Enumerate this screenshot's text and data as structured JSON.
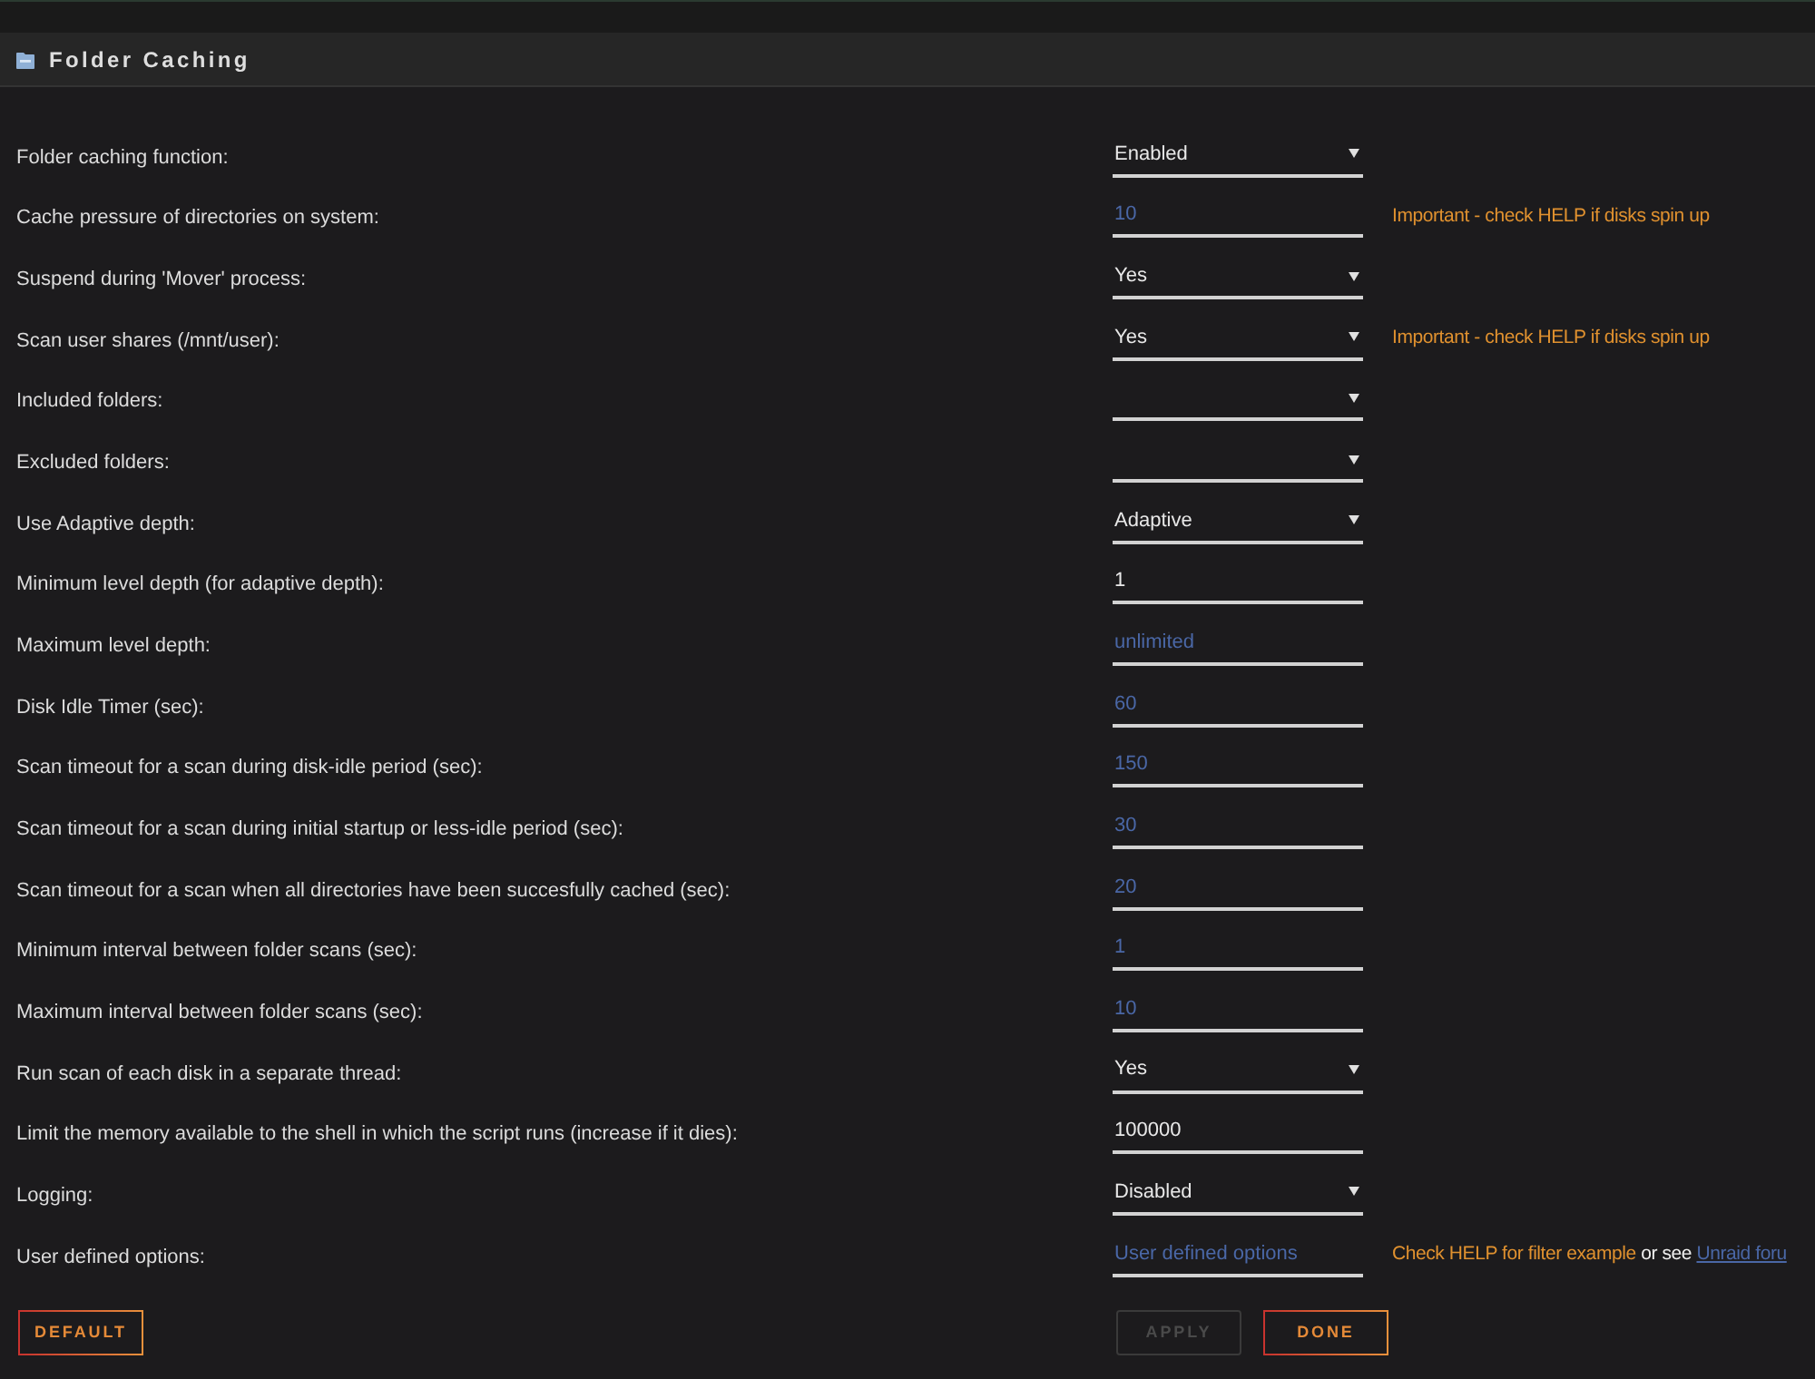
{
  "header": {
    "title": "Folder Caching"
  },
  "settings": [
    {
      "label": "Folder caching function:",
      "field": {
        "kind": "select",
        "value": "Enabled"
      }
    },
    {
      "label": "Cache pressure of directories on system:",
      "field": {
        "kind": "input",
        "placeholder": "10"
      },
      "note": [
        {
          "kind": "warning",
          "text": "Important - check HELP if disks spin up"
        }
      ]
    },
    {
      "label": "Suspend during 'Mover' process:",
      "field": {
        "kind": "select",
        "value": "Yes"
      }
    },
    {
      "label": "Scan user shares (/mnt/user):",
      "field": {
        "kind": "select",
        "value": "Yes"
      },
      "note": [
        {
          "kind": "warning",
          "text": "Important - check HELP if disks spin up"
        }
      ]
    },
    {
      "label": "Included folders:",
      "field": {
        "kind": "select"
      }
    },
    {
      "label": "Excluded folders:",
      "field": {
        "kind": "select"
      }
    },
    {
      "label": "Use Adaptive depth:",
      "field": {
        "kind": "select",
        "value": "Adaptive"
      }
    },
    {
      "label": "Minimum level depth (for adaptive depth):",
      "field": {
        "kind": "input",
        "value": "1"
      }
    },
    {
      "label": "Maximum level depth:",
      "field": {
        "kind": "input",
        "placeholder": "unlimited"
      }
    },
    {
      "label": "Disk Idle Timer (sec):",
      "field": {
        "kind": "input",
        "placeholder": "60"
      }
    },
    {
      "label": "Scan timeout for a scan during disk-idle period (sec):",
      "field": {
        "kind": "input",
        "placeholder": "150"
      }
    },
    {
      "label": "Scan timeout for a scan during initial startup or less-idle period (sec):",
      "field": {
        "kind": "input",
        "placeholder": "30"
      }
    },
    {
      "label": "Scan timeout for a scan when all directories have been succesfully cached (sec):",
      "field": {
        "kind": "input",
        "placeholder": "20"
      }
    },
    {
      "label": "Minimum interval between folder scans (sec):",
      "field": {
        "kind": "input",
        "placeholder": "1"
      }
    },
    {
      "label": "Maximum interval between folder scans (sec):",
      "field": {
        "kind": "input",
        "placeholder": "10"
      }
    },
    {
      "label": "Run scan of each disk in a separate thread:",
      "field": {
        "kind": "select",
        "value": "Yes"
      }
    },
    {
      "label": "Limit the memory available to the shell in which the script runs (increase if it dies):",
      "field": {
        "kind": "input",
        "value": "100000"
      }
    },
    {
      "label": "Logging:",
      "field": {
        "kind": "select",
        "value": "Disabled"
      }
    },
    {
      "label": "User defined options:",
      "field": {
        "kind": "input",
        "placeholder": "User defined options"
      },
      "note": [
        {
          "kind": "warning",
          "text": "Check HELP for filter example"
        },
        {
          "kind": "plain",
          "text": "or see"
        },
        {
          "kind": "link",
          "text": "Unraid foru"
        }
      ]
    }
  ],
  "buttons": [
    {
      "label": "DEFAULT",
      "disabled": false
    },
    {
      "label": "APPLY",
      "disabled": true
    },
    {
      "label": "DONE",
      "disabled": false
    }
  ]
}
